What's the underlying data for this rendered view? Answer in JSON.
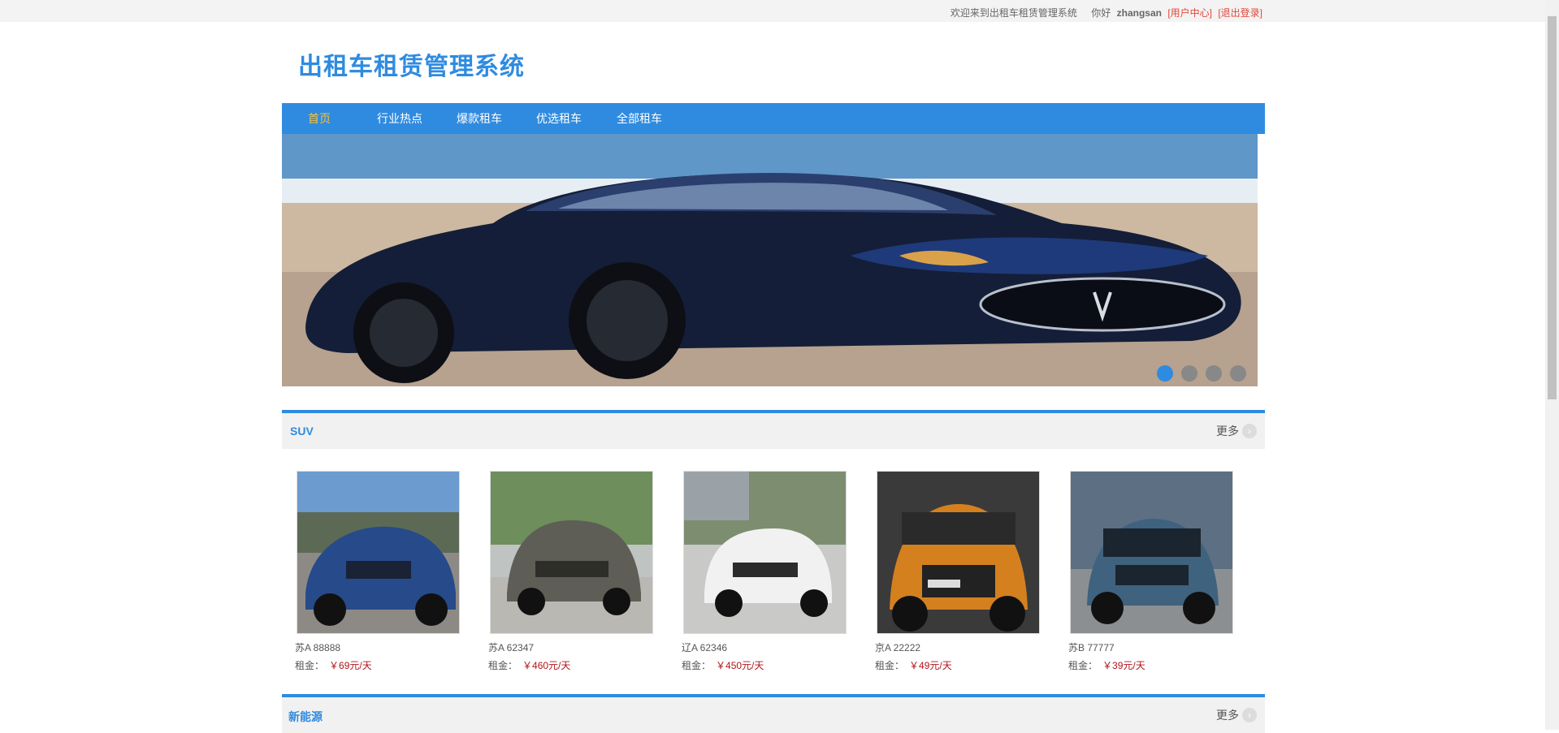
{
  "topbar": {
    "welcome": "欢迎来到出租车租赁管理系统",
    "hello": "你好",
    "username": "zhangsan",
    "user_center": "[用户中心]",
    "logout": "[退出登录]"
  },
  "logo": "出租车租赁管理系统",
  "nav": [
    "首页",
    "行业热点",
    "爆款租车",
    "优选租车",
    "全部租车"
  ],
  "banner": {
    "dot_count": 4,
    "active_dot": 1
  },
  "sections": [
    {
      "title": "SUV",
      "more": "更多",
      "cars": [
        {
          "plate": "苏A 88888",
          "rent_label": "租金：",
          "price": "￥69元/天"
        },
        {
          "plate": "苏A 62347",
          "rent_label": "租金：",
          "price": "￥460元/天"
        },
        {
          "plate": "辽A 62346",
          "rent_label": "租金：",
          "price": "￥450元/天"
        },
        {
          "plate": "京A 22222",
          "rent_label": "租金：",
          "price": "￥49元/天"
        },
        {
          "plate": "苏B 77777",
          "rent_label": "租金：",
          "price": "￥39元/天"
        }
      ]
    },
    {
      "title": "新能源",
      "more": "更多"
    }
  ],
  "colors": {
    "primary": "#2f8be0",
    "nav_active": "#f5c33b",
    "price": "#b0141b",
    "link_red": "#e4463a"
  }
}
